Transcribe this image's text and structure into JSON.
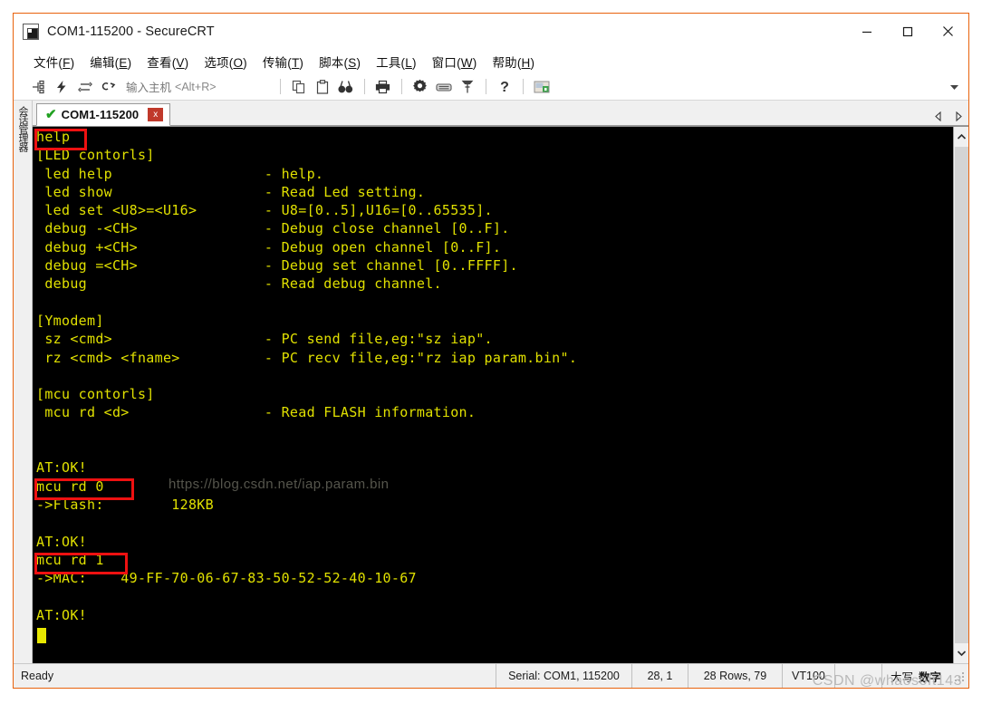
{
  "window": {
    "title": "COM1-115200 - SecureCRT",
    "icon": "securecrt-app-icon",
    "minimize_label": "—",
    "maximize_label": "□",
    "close_label": "✕"
  },
  "menubar": {
    "items": [
      {
        "name": "file",
        "text": "文件",
        "accel": "F"
      },
      {
        "name": "edit",
        "text": "编辑",
        "accel": "E"
      },
      {
        "name": "view",
        "text": "查看",
        "accel": "V"
      },
      {
        "name": "options",
        "text": "选项",
        "accel": "O"
      },
      {
        "name": "transfer",
        "text": "传输",
        "accel": "T"
      },
      {
        "name": "script",
        "text": "脚本",
        "accel": "S"
      },
      {
        "name": "tools",
        "text": "工具",
        "accel": "L"
      },
      {
        "name": "window",
        "text": "窗口",
        "accel": "W"
      },
      {
        "name": "help",
        "text": "帮助",
        "accel": "H"
      }
    ]
  },
  "toolbar": {
    "host_label": "输入主机",
    "host_key": "<Alt+R>",
    "icons": [
      "connect-icon",
      "quick-connect-icon",
      "reconnect-icon",
      "disconnect-icon",
      "copy-icon",
      "paste-icon",
      "find-icon",
      "print-icon",
      "session-options-icon",
      "keymap-editor-icon",
      "key-icon",
      "help-icon",
      "protocol-icon"
    ],
    "overflow_label": "▾"
  },
  "sidebar": {
    "label": "会话管理器"
  },
  "tabs": {
    "items": [
      {
        "name": "com1-session",
        "label": "COM1-115200",
        "status_icon": "connected-check-icon",
        "close_label": "x"
      }
    ],
    "nav_prev": "tab-prev-icon",
    "nav_next": "tab-next-icon"
  },
  "terminal": {
    "foreground": "#e0e000",
    "background": "#000000",
    "cursor": "block-cursor",
    "watermark": "https://blog.csdn.net/iap.param.bin",
    "lines": [
      "help",
      "[LED contorls]",
      " led help                  - help.",
      " led show                  - Read Led setting.",
      " led set <U8>=<U16>        - U8=[0..5],U16=[0..65535].",
      " debug -<CH>               - Debug close channel [0..F].",
      " debug +<CH>               - Debug open channel [0..F].",
      " debug =<CH>               - Debug set channel [0..FFFF].",
      " debug                     - Read debug channel.",
      "",
      "[Ymodem]",
      " sz <cmd>                  - PC send file,eg:\"sz iap\".",
      " rz <cmd> <fname>          - PC recv file,eg:\"rz iap param.bin\".",
      "",
      "[mcu contorls]",
      " mcu rd <d>                - Read FLASH information.",
      "",
      "",
      "AT:OK!",
      "mcu rd 0",
      "->Flash:        128KB",
      "",
      "AT:OK!",
      "mcu rd 1",
      "->MAC:    49-FF-70-06-67-83-50-52-52-40-10-67",
      "",
      "AT:OK!"
    ],
    "annotations": [
      {
        "name": "annotation-help-command",
        "text": "help"
      },
      {
        "name": "annotation-mcu-rd-0",
        "text": "mcu rd 0"
      },
      {
        "name": "annotation-mcu-rd-1",
        "text": "mcu rd 1"
      }
    ],
    "scroll_up": "scroll-up-icon",
    "scroll_down": "scroll-down-icon"
  },
  "statusbar": {
    "ready": "Ready",
    "serial": "Serial: COM1, 115200",
    "position": "28,  1",
    "rows": "28 Rows, 79",
    "emulation": "VT100",
    "blank": "",
    "caps": "大写",
    "num": "数字"
  },
  "page": {
    "watermark": "CSDN @whaosoft143"
  }
}
